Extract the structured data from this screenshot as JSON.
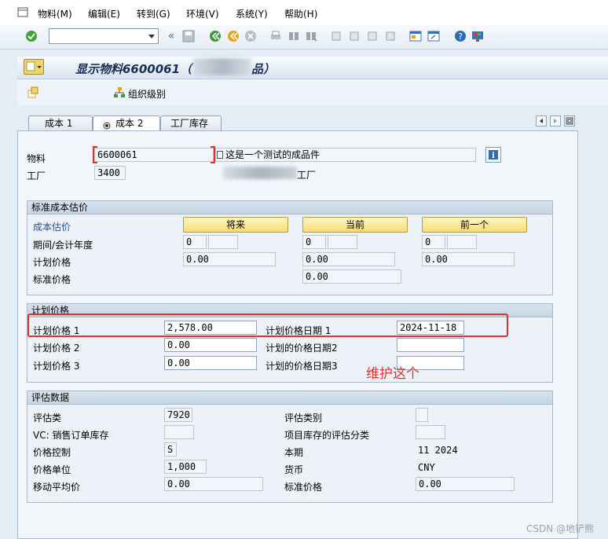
{
  "menu": {
    "items": [
      "物料(M)",
      "编辑(E)",
      "转到(G)",
      "环境(V)",
      "系统(Y)",
      "帮助(H)"
    ]
  },
  "toolbar": {
    "command_value": ""
  },
  "title": "显示物料6600061（",
  "title_tail": "品）",
  "org_levels_label": "组织级别",
  "tabs": [
    {
      "label": "成本 1",
      "active": false
    },
    {
      "label": "成本 2",
      "active": true
    },
    {
      "label": "工厂库存",
      "active": false
    }
  ],
  "header": {
    "material_label": "物料",
    "material_value": "6600061",
    "material_desc": "这是一个测试的成品件",
    "plant_label": "工厂",
    "plant_value": "3400",
    "plant_desc": "工厂"
  },
  "std_estimate": {
    "title": "标准成本估价",
    "estimate_label": "成本估价",
    "buttons": [
      "将来",
      "当前",
      "前一个"
    ],
    "period_label": "期间/会计年度",
    "periods": [
      "0",
      "0",
      "0"
    ],
    "planned_price_label": "计划价格",
    "planned_prices": [
      "0.00",
      "0.00",
      "0.00"
    ],
    "standard_price_label": "标准价格",
    "standard_price": "0.00"
  },
  "planned_prices": {
    "title": "计划价格",
    "rows": [
      {
        "label": "计划价格 1",
        "value": "2,578.00",
        "date_label": "计划价格日期 1",
        "date": "2024-11-18"
      },
      {
        "label": "计划价格 2",
        "value": "0.00",
        "date_label": "计划的价格日期2",
        "date": ""
      },
      {
        "label": "计划价格 3",
        "value": "0.00",
        "date_label": "计划的价格日期3",
        "date": ""
      }
    ],
    "annotation": "维护这个",
    "annotation_color": "#e0312b"
  },
  "valuation": {
    "title": "评估数据",
    "left": [
      {
        "label": "评估类",
        "value": "7920"
      },
      {
        "label": "VC: 销售订单库存",
        "value": ""
      },
      {
        "label": "价格控制",
        "value": "S"
      },
      {
        "label": "价格单位",
        "value": "1,000"
      },
      {
        "label": "移动平均价",
        "value": "0.00"
      }
    ],
    "right": [
      {
        "label": "评估类别",
        "value": ""
      },
      {
        "label": "项目库存的评估分类",
        "value": ""
      },
      {
        "label": "本期",
        "value": "11 2024"
      },
      {
        "label": "货币",
        "value": "CNY"
      },
      {
        "label": "标准价格",
        "value": "0.00"
      }
    ]
  },
  "watermark": "CSDN @地铲熊"
}
